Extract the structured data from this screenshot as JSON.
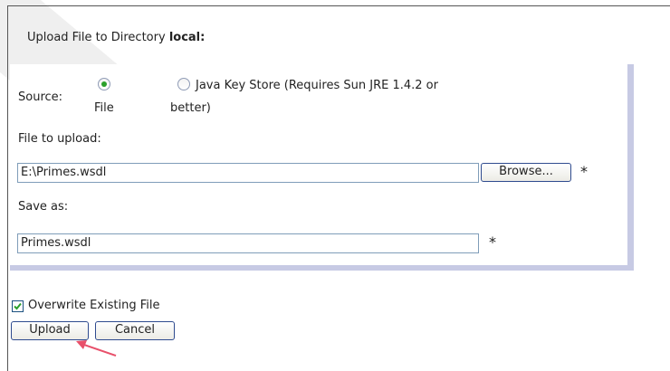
{
  "heading": {
    "prefix": "Upload File to Directory ",
    "directory": "local:"
  },
  "form": {
    "source_label": "Source:",
    "source_options": [
      {
        "label": "File",
        "selected": true
      },
      {
        "label_line1": "Java Key Store (Requires Sun JRE 1.4.2 or",
        "label_line2": "better)",
        "selected": false
      }
    ],
    "file_to_upload_label": "File to upload:",
    "file_to_upload_value": "E:\\Primes.wsdl",
    "browse_label": "Browse...",
    "save_as_label": "Save as:",
    "save_as_value": "Primes.wsdl",
    "required_mark": "*"
  },
  "overwrite": {
    "label": "Overwrite Existing File",
    "checked": true
  },
  "actions": {
    "upload_label": "Upload",
    "cancel_label": "Cancel"
  },
  "colors": {
    "panel_border": "#c7cae4",
    "radio_selected": "#2aa02a",
    "annotation_arrow": "#e8506a"
  }
}
